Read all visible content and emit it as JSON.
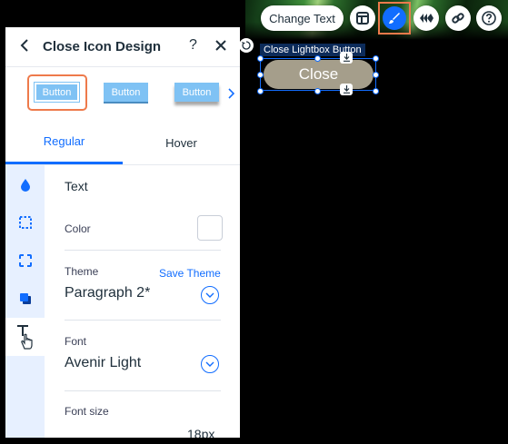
{
  "toolbar": {
    "change_text_label": "Change Text",
    "accent_color": "#116dff",
    "selected_outline_color": "#ee7a4b"
  },
  "canvas": {
    "element_label": "Close Lightbox Button",
    "button_text": "Close",
    "button_color": "#a59e8b"
  },
  "panel": {
    "title": "Close Icon Design",
    "help_glyph": "?",
    "presets": [
      {
        "label": "Button"
      },
      {
        "label": "Button"
      },
      {
        "label": "Button"
      }
    ],
    "tabs": [
      {
        "label": "Regular",
        "active": true
      },
      {
        "label": "Hover",
        "active": false
      }
    ],
    "sidebar": [
      {
        "icon": "fill-drop-icon"
      },
      {
        "icon": "border-dashed-icon"
      },
      {
        "icon": "corners-icon"
      },
      {
        "icon": "shadow-icon"
      },
      {
        "icon": "text-icon",
        "active": true
      }
    ],
    "text_section": {
      "title": "Text",
      "color_label": "Color",
      "theme_label": "Theme",
      "save_theme_link": "Save Theme",
      "theme_value": "Paragraph 2*",
      "font_label": "Font",
      "font_value": "Avenir Light",
      "font_size_label": "Font size",
      "font_size_value": "18px"
    }
  }
}
